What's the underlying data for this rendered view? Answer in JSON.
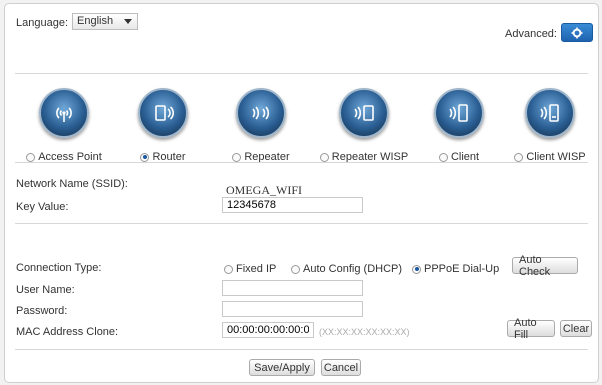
{
  "header": {
    "language_label": "Language:",
    "language_value": "English",
    "advanced_label": "Advanced:"
  },
  "modes": [
    {
      "label": "Access Point",
      "icon": "access-point-icon",
      "selected": false
    },
    {
      "label": "Router",
      "icon": "router-icon",
      "selected": true
    },
    {
      "label": "Repeater",
      "icon": "repeater-icon",
      "selected": false
    },
    {
      "label": "Repeater WISP",
      "icon": "repeater-wisp-icon",
      "selected": false
    },
    {
      "label": "Client",
      "icon": "client-icon",
      "selected": false
    },
    {
      "label": "Client WISP",
      "icon": "client-wisp-icon",
      "selected": false
    }
  ],
  "wifi": {
    "ssid_label": "Network Name (SSID):",
    "ssid_value": "OMEGA_WIFI",
    "key_label": "Key Value:",
    "key_value": "12345678"
  },
  "wan": {
    "connection_type_label": "Connection Type:",
    "options": [
      {
        "label": "Fixed IP",
        "selected": false
      },
      {
        "label": "Auto Config (DHCP)",
        "selected": false
      },
      {
        "label": "PPPoE Dial-Up",
        "selected": true
      }
    ],
    "auto_check_label": "Auto Check",
    "username_label": "User Name:",
    "username_value": "",
    "password_label": "Password:",
    "password_value": "",
    "mac_label": "MAC Address Clone:",
    "mac_value": "00:00:00:00:00:00",
    "mac_hint": "(XX:XX:XX:XX:XX:XX)",
    "auto_fill_label": "Auto Fill",
    "clear_label": "Clear"
  },
  "footer": {
    "save_label": "Save/Apply",
    "cancel_label": "Cancel"
  },
  "colors": {
    "accent": "#1d63b0",
    "icon_ring": "#2a5e93"
  }
}
